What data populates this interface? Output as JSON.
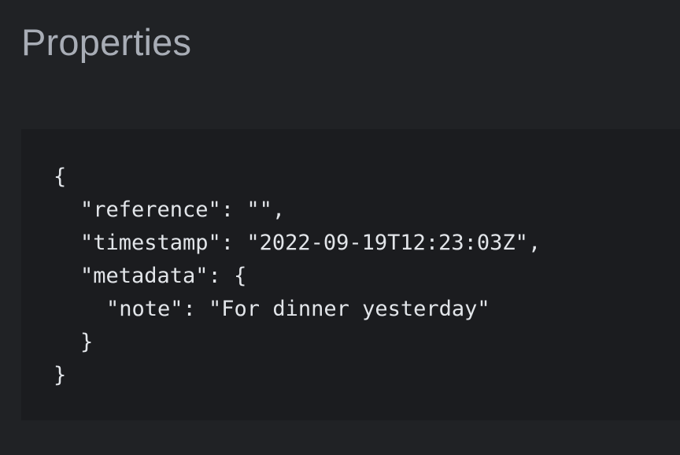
{
  "header": {
    "title": "Properties"
  },
  "code_block": {
    "lines": [
      {
        "indent": 0,
        "text": "{"
      },
      {
        "indent": 1,
        "text": "\"reference\": \"\","
      },
      {
        "indent": 1,
        "text": "\"timestamp\": \"2022-09-19T12:23:03Z\","
      },
      {
        "indent": 1,
        "text": "\"metadata\": {"
      },
      {
        "indent": 2,
        "text": "\"note\": \"For dinner yesterday\""
      },
      {
        "indent": 1,
        "text": "}"
      },
      {
        "indent": 0,
        "text": "}"
      }
    ]
  },
  "colors": {
    "background": "#202225",
    "code_background": "#1b1c1f",
    "title_text": "#a8adb6",
    "code_text": "#e2e5e9"
  }
}
